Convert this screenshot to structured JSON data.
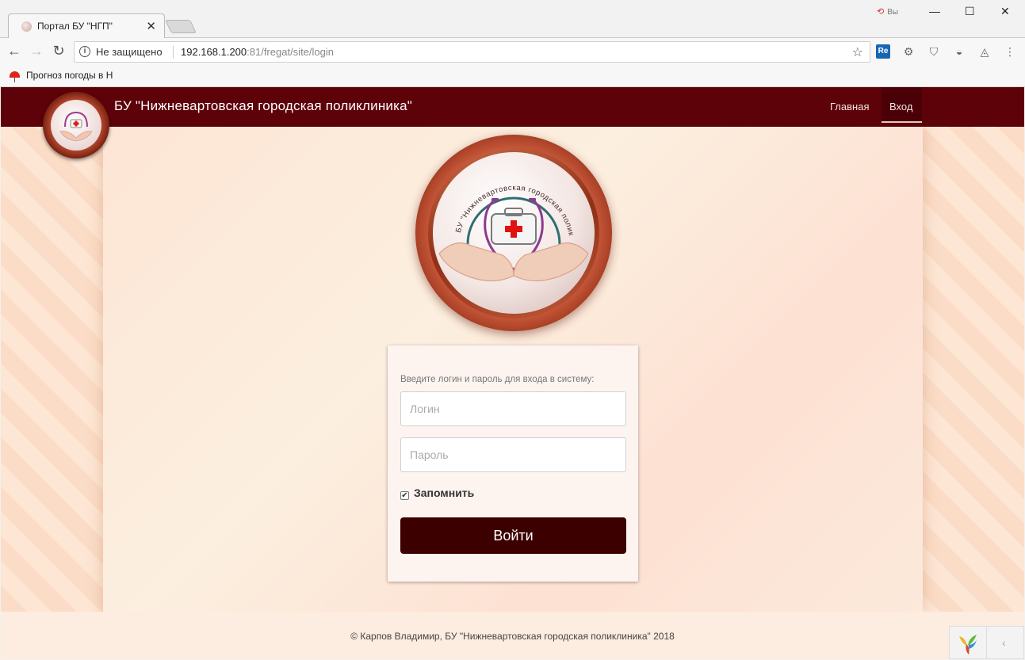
{
  "browser": {
    "tab_title": "Портал БУ \"НГП\"",
    "tab_close": "✕",
    "profile_label": "Вы",
    "security_text": "Не защищено",
    "url_host": "192.168.1.200",
    "url_rest": ":81/fregat/site/login",
    "bookmark_label": "Прогноз погоды в Н"
  },
  "header": {
    "title": "БУ \"Нижневартовская городская поликлиника\"",
    "nav": [
      {
        "label": "Главная",
        "active": false
      },
      {
        "label": "Вход",
        "active": true
      }
    ]
  },
  "logo": {
    "arc_text": "БУ \"Нижневартовская городская поликлиника\""
  },
  "login": {
    "prompt": "Введите логин и пароль для входа в систему:",
    "username_placeholder": "Логин",
    "username_value": "",
    "password_placeholder": "Пароль",
    "password_value": "",
    "remember_label": "Запомнить",
    "remember_checked": true,
    "submit_label": "Войти"
  },
  "footer": {
    "text": "© Карпов Владимир, БУ \"Нижневартовская городская поликлиника\" 2018"
  },
  "colors": {
    "header_bg": "#5e020a",
    "button_bg": "#3d0000",
    "stripe_light": "#fde6d4",
    "stripe_dark": "#fbdcc6"
  }
}
